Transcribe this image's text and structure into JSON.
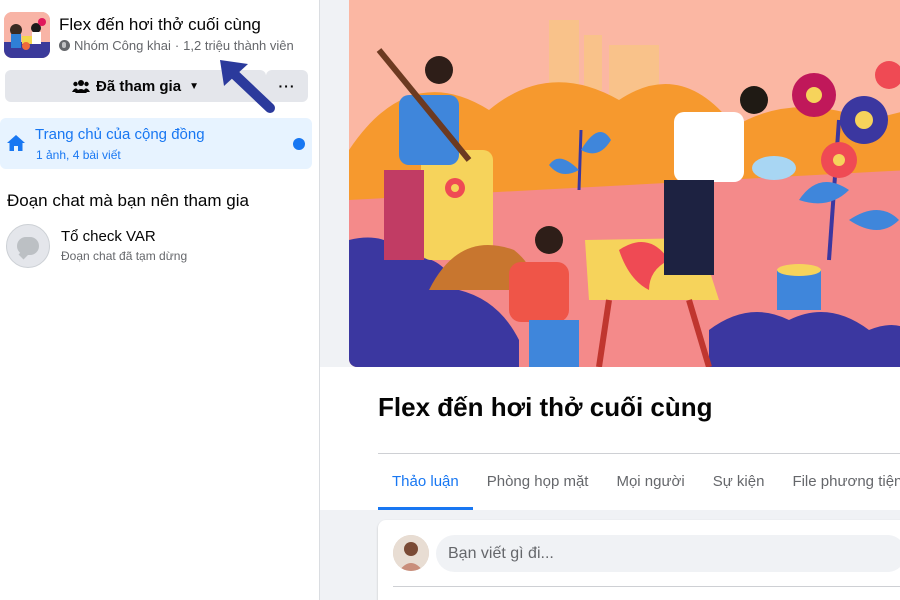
{
  "group": {
    "title": "Flex đến hơi thở cuối cùng",
    "privacy": "Nhóm Công khai",
    "separator": "·",
    "members": "1,2 triệu thành viên"
  },
  "actions": {
    "joined_label": "Đã tham gia",
    "more_label": "···"
  },
  "community_home": {
    "title": "Trang chủ của cộng đồng",
    "subtitle": "1 ảnh, 4 bài viết"
  },
  "suggested_chats": {
    "heading": "Đoạn chat mà bạn nên tham gia",
    "items": [
      {
        "name": "Tổ check VAR",
        "status": "Đoạn chat đã tạm dừng"
      }
    ]
  },
  "main": {
    "title": "Flex đến hơi thở cuối cùng",
    "tabs": [
      {
        "label": "Thảo luận",
        "active": true
      },
      {
        "label": "Phòng họp mặt",
        "active": false
      },
      {
        "label": "Mọi người",
        "active": false
      },
      {
        "label": "Sự kiện",
        "active": false
      },
      {
        "label": "File phương tiện",
        "active": false
      }
    ],
    "composer_placeholder": "Bạn viết gì đi..."
  },
  "colors": {
    "accent": "#1877f2",
    "annotation_arrow": "#2b3a9c",
    "cover_bg": "#fbb7a3"
  }
}
